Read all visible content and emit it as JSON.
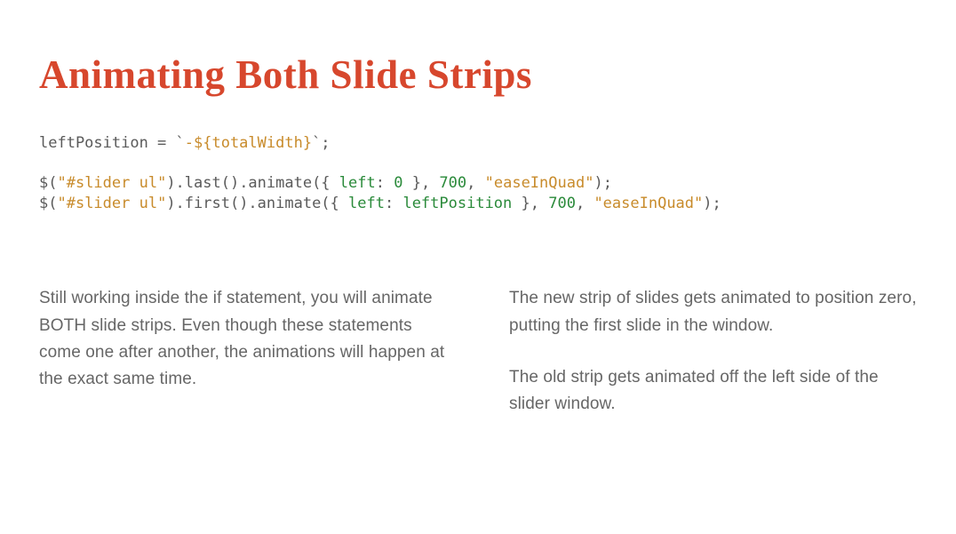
{
  "title": "Animating Both Slide Strips",
  "code": {
    "l1": {
      "a": "leftPosition = `",
      "b": "-${totalWidth}",
      "c": "`;"
    },
    "l2": {
      "a": "$(",
      "b": "\"#slider ul\"",
      "c": ").last().animate({ ",
      "d": "left",
      "e": ": ",
      "f": "0",
      "g": " }, ",
      "h": "700",
      "i": ", ",
      "j": "\"easeInQuad\"",
      "k": ");"
    },
    "l3": {
      "a": "$(",
      "b": "\"#slider ul\"",
      "c": ").first().animate({ ",
      "d": "left",
      "e": ": ",
      "f": "leftPosition",
      "g": " }, ",
      "h": "700",
      "i": ", ",
      "j": "\"easeInQuad\"",
      "k": ");"
    }
  },
  "columns": {
    "left": {
      "p1": "Still working inside the if statement, you will animate BOTH slide strips. Even though these statements come one after another, the animations will happen at the exact same time."
    },
    "right": {
      "p1": "The new strip of slides gets animated to position zero, putting the first slide in the window.",
      "p2": "The old strip gets animated off the left side of the slider window."
    }
  }
}
